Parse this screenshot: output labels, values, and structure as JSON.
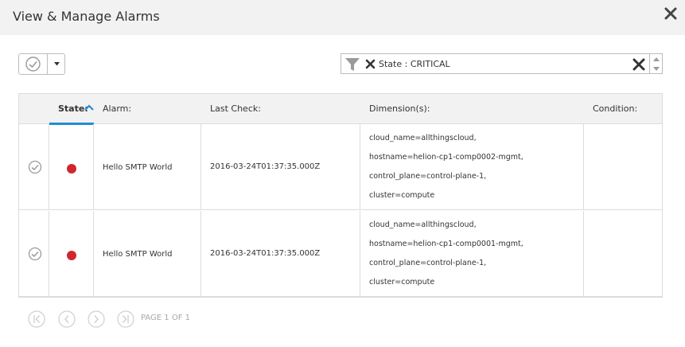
{
  "dialog": {
    "title": "View & Manage Alarms",
    "close_icon": "close-icon"
  },
  "toolbar": {
    "select_icon": "checkmark-circle-icon",
    "caret_icon": "caret-down-icon"
  },
  "filter": {
    "funnel_icon": "funnel-icon",
    "chip_label": "State : CRITICAL",
    "chip_remove_icon": "close-icon",
    "clear_icon": "close-icon"
  },
  "table": {
    "columns": {
      "state": "State:",
      "alarm": "Alarm:",
      "last_check": "Last Check:",
      "dimensions": "Dimension(s):",
      "condition": "Condition:"
    },
    "sort_icon": "chevron-up-icon",
    "rows": [
      {
        "state": "CRITICAL",
        "alarm": "Hello SMTP World",
        "last_check": "2016-03-24T01:37:35.000Z",
        "dimensions": [
          "cloud_name=allthingscloud,",
          "hostname=helion-cp1-comp0002-mgmt,",
          "control_plane=control-plane-1,",
          "cluster=compute"
        ],
        "condition": ""
      },
      {
        "state": "CRITICAL",
        "alarm": "Hello SMTP World",
        "last_check": "2016-03-24T01:37:35.000Z",
        "dimensions": [
          "cloud_name=allthingscloud,",
          "hostname=helion-cp1-comp0001-mgmt,",
          "control_plane=control-plane-1,",
          "cluster=compute"
        ],
        "condition": ""
      }
    ]
  },
  "pagination": {
    "label": "PAGE 1 OF 1",
    "buttons": [
      "first-page-icon",
      "prev-page-icon",
      "next-page-icon",
      "last-page-icon"
    ]
  },
  "colors": {
    "accent": "#1f8ed6",
    "critical": "#d0262e",
    "header_bg": "#f2f2f2",
    "border": "#dcdcdc"
  }
}
